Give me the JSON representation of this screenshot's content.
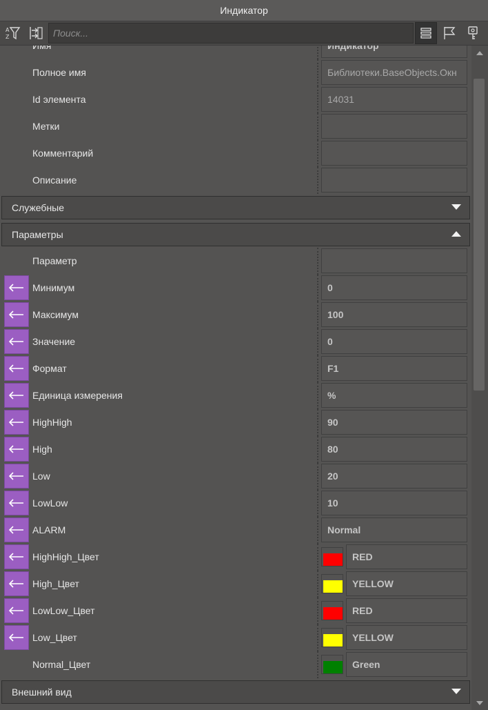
{
  "window": {
    "title": "Индикатор"
  },
  "toolbar": {
    "search_placeholder": "Поиск..."
  },
  "general": {
    "name": {
      "label": "Имя",
      "value": "Индикатор"
    },
    "fullname": {
      "label": "Полное имя",
      "value": "Библиотеки.BaseObjects.Окн"
    },
    "id": {
      "label": "Id элемента",
      "value": "14031"
    },
    "tags": {
      "label": "Метки",
      "value": ""
    },
    "comment": {
      "label": "Комментарий",
      "value": ""
    },
    "description": {
      "label": "Описание",
      "value": ""
    }
  },
  "sections": {
    "service": "Служебные",
    "parameters": "Параметры",
    "appearance": "Внешний вид"
  },
  "params": {
    "param": {
      "label": "Параметр",
      "value": ""
    },
    "min": {
      "label": "Минимум",
      "value": "0"
    },
    "max": {
      "label": "Максимум",
      "value": "100"
    },
    "value": {
      "label": "Значение",
      "value": "0"
    },
    "format": {
      "label": "Формат",
      "value": "F1"
    },
    "unit": {
      "label": "Единица измерения",
      "value": "%"
    },
    "highhigh": {
      "label": "HighHigh",
      "value": "90"
    },
    "high": {
      "label": "High",
      "value": "80"
    },
    "low": {
      "label": "Low",
      "value": "20"
    },
    "lowlow": {
      "label": "LowLow",
      "value": "10"
    },
    "alarm": {
      "label": "ALARM",
      "value": "Normal"
    },
    "highhigh_color": {
      "label": "HighHigh_Цвет",
      "value": "RED",
      "color": "#ff0000"
    },
    "high_color": {
      "label": "High_Цвет",
      "value": "YELLOW",
      "color": "#ffff00"
    },
    "lowlow_color": {
      "label": "LowLow_Цвет",
      "value": "RED",
      "color": "#ff0000"
    },
    "low_color": {
      "label": "Low_Цвет",
      "value": "YELLOW",
      "color": "#ffff00"
    },
    "normal_color": {
      "label": "Normal_Цвет",
      "value": "Green",
      "color": "#008000"
    }
  },
  "colors": {
    "bind_button": "#9b5ec2",
    "panel_bg": "#545352"
  }
}
